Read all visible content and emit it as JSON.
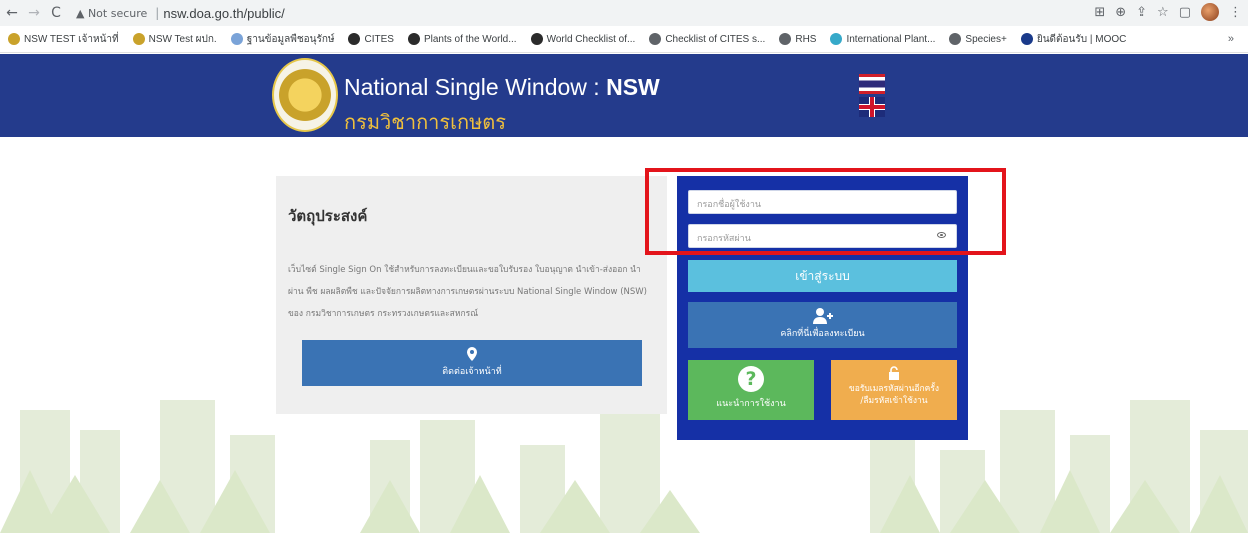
{
  "browser": {
    "back": "←",
    "forward": "→",
    "reload": "C",
    "security": "▲ Not secure",
    "url": "nsw.doa.go.th/public/",
    "menu": "⋮",
    "bookmarks": [
      {
        "label": "NSW TEST เจ้าหน้าที่",
        "color": "#c9a22b"
      },
      {
        "label": "NSW Test ผปก.",
        "color": "#c9a22b"
      },
      {
        "label": "ฐานข้อมูลพืชอนุรักษ์",
        "color": "#7aa3d8"
      },
      {
        "label": "CITES",
        "color": "#2b2b2b"
      },
      {
        "label": "Plants of the World...",
        "color": "#2b2b2b"
      },
      {
        "label": "World Checklist of...",
        "color": "#2b2b2b"
      },
      {
        "label": "Checklist of CITES s...",
        "color": "#5f6368"
      },
      {
        "label": "RHS",
        "color": "#5f6368"
      },
      {
        "label": "International Plant...",
        "color": "#36a9c9"
      },
      {
        "label": "Species+",
        "color": "#5f6368"
      },
      {
        "label": "ยินดีต้อนรับ | MOOC",
        "color": "#1a3a8a"
      }
    ],
    "more": "»"
  },
  "header": {
    "title_main": "National Single Window : ",
    "title_bold": "NSW",
    "subtitle": "กรมวิชาการเกษตร"
  },
  "objective": {
    "title": "วัตถุประสงค์",
    "text": "เว็บไซต์ Single Sign On ใช้สำหรับการลงทะเบียนและขอใบรับรอง ใบอนุญาต นำเข้า-ส่งออก นำผ่าน พืช ผลผลิตพืช และปัจจัยการผลิตทางการเกษตรผ่านระบบ National Single Window (NSW) ของ กรมวิชาการเกษตร กระทรวงเกษตรและสหกรณ์",
    "contact_label": "ติดต่อเจ้าหน้าที่"
  },
  "login": {
    "username_placeholder": "กรอกชื่อผู้ใช้งาน",
    "password_placeholder": "กรอกรหัสผ่าน",
    "login_label": "เข้าสู่ระบบ",
    "register_label": "คลิกที่นี่เพื่อลงทะเบียน",
    "guide_label": "แนะนำการใช้งาน",
    "reset_line1": "ขอรับเมลรหัสผ่านอีกครั้ง",
    "reset_line2": "/ลืมรหัสเข้าใช้งาน"
  },
  "colors": {
    "banner": "#243b8c",
    "login_panel": "#1530a6",
    "login_button": "#5bc0de",
    "register_button": "#3a73b4",
    "guide_button": "#5cb85c",
    "reset_button": "#f0ad4e",
    "highlight": "#e3141b"
  }
}
